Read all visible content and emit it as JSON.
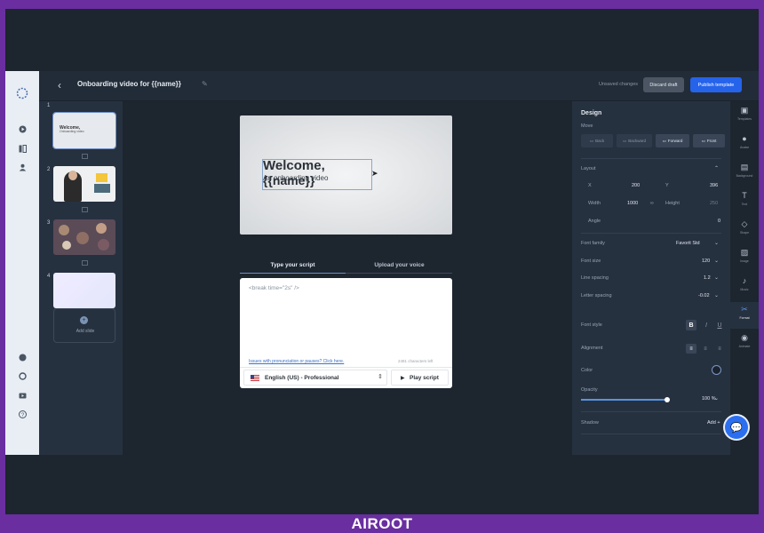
{
  "header": {
    "title": "Onboarding video for {{name}}",
    "unsaved": "Unsaved changes",
    "discard": "Discard draft",
    "publish": "Publish template"
  },
  "slides": [
    {
      "num": "1",
      "title": "Welcome,",
      "sub": "Onboarding video"
    },
    {
      "num": "2"
    },
    {
      "num": "3"
    },
    {
      "num": "4"
    }
  ],
  "add_slide": "Add slide",
  "canvas": {
    "welcome": "Welcome,",
    "sub": "An onboarding video",
    "name_var": "{{name}}"
  },
  "script": {
    "tab_type": "Type your script",
    "tab_upload": "Upload your voice",
    "text": "<break time=\"2s\" />",
    "issue": "Issues with pronunciation or pauses? Click here.",
    "chars": "2481 characters left",
    "language": "English (US) - Professional",
    "play": "Play script"
  },
  "design": {
    "title": "Design",
    "move": "Move",
    "move_back": "Back",
    "move_backward": "Backward",
    "move_forward": "Forward",
    "move_front": "Front",
    "layout": "Layout",
    "x_label": "X",
    "x_val": "200",
    "y_label": "Y",
    "y_val": "396",
    "width_label": "Width",
    "width_val": "1000",
    "height_label": "Height",
    "height_val": "250",
    "angle_label": "Angle",
    "angle_val": "0",
    "font_family_label": "Font family",
    "font_family_val": "Favorit Std",
    "font_size_label": "Font size",
    "font_size_val": "120",
    "line_spacing_label": "Line spacing",
    "line_spacing_val": "1.2",
    "letter_spacing_label": "Letter spacing",
    "letter_spacing_val": "-0.02",
    "font_style_label": "Font style",
    "alignment_label": "Alignment",
    "color_label": "Color",
    "opacity_label": "Opacity",
    "opacity_val": "100 %",
    "opacity_level": 1.0,
    "shadow_label": "Shadow",
    "shadow_add": "Add +"
  },
  "right_rail": {
    "templates": "Templates",
    "avatar": "Avatar",
    "background": "Background",
    "text": "Text",
    "shape": "Shape",
    "image": "Image",
    "music": "Music",
    "format": "Format",
    "animate": "Animate"
  },
  "brand": "AIROOT",
  "colors": {
    "accent": "#2563eb",
    "frame": "#6a2ea0"
  }
}
